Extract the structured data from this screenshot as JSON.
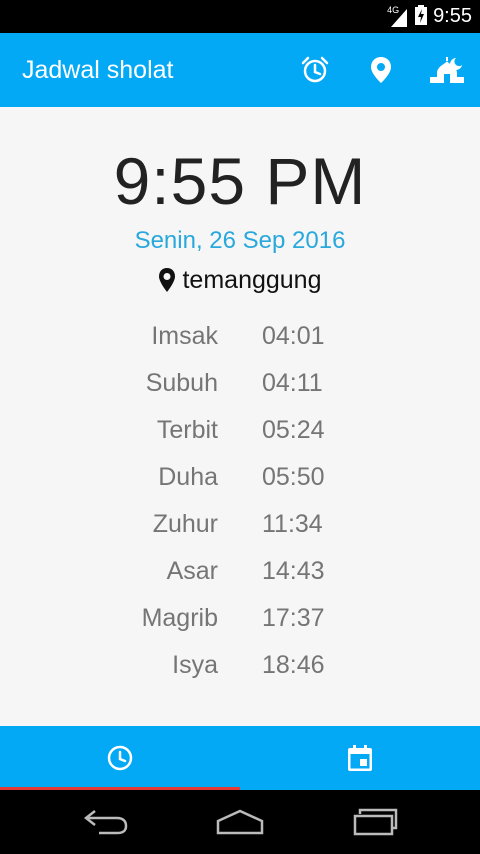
{
  "status_bar": {
    "network": "4G",
    "time": "9:55"
  },
  "app_bar": {
    "title": "Jadwal sholat"
  },
  "clock": {
    "time": "9:55 PM",
    "date": "Senin, 26 Sep 2016",
    "location": "temanggung"
  },
  "prayers": [
    {
      "name": "Imsak",
      "time": "04:01"
    },
    {
      "name": "Subuh",
      "time": "04:11"
    },
    {
      "name": "Terbit",
      "time": "05:24"
    },
    {
      "name": "Duha",
      "time": "05:50"
    },
    {
      "name": "Zuhur",
      "time": "11:34"
    },
    {
      "name": "Asar",
      "time": "14:43"
    },
    {
      "name": "Magrib",
      "time": "17:37"
    },
    {
      "name": "Isya",
      "time": "18:46"
    }
  ],
  "colors": {
    "primary": "#03a9f4",
    "date": "#29a8dc",
    "indicator": "#e53935"
  }
}
